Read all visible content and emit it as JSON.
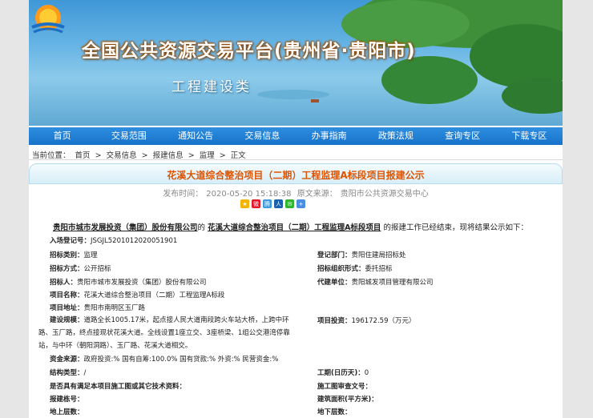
{
  "header": {
    "site_title": "全国公共资源交易平台(贵州省·贵阳市)",
    "site_subtitle": "工程建设类"
  },
  "nav": [
    "首页",
    "交易范围",
    "通知公告",
    "交易信息",
    "办事指南",
    "政策法规",
    "查询专区",
    "下载专区"
  ],
  "breadcrumb": {
    "prefix": "当前位置：",
    "items": [
      "首页",
      ">",
      "交易信息",
      ">",
      "报建信息",
      ">",
      "监理",
      ">",
      "正文"
    ]
  },
  "article": {
    "title": "花溪大道综合整治项目（二期）工程监理A标段项目报建公示",
    "publish_label": "发布时间：",
    "publish_time": "2020-05-20 15:18:38",
    "source_label": "原文来源：",
    "source": "贵阳市公共资源交易中心",
    "share_icons": [
      "qzone-icon",
      "weibo-icon",
      "tencent-weibo-icon",
      "renren-icon",
      "wechat-icon",
      "more-share-icon"
    ],
    "intro": {
      "org": "贵阳市城市发展投资（集团）股份有限公司",
      "mid": "的",
      "project": "花溪大道综合整治项目（二期）工程监理A标段项目",
      "tail": "的报建工作已经结束，现将结果公示如下："
    },
    "fields": {
      "reg_no_label": "入场登记号：",
      "reg_no": "JSGJL5201012020051901",
      "bid_type_label": "招标类别：",
      "bid_type": "监理",
      "reg_dept_label": "登记部门：",
      "reg_dept": "贵阳住建局招标处",
      "bid_method_label": "招标方式：",
      "bid_method": "公开招标",
      "bid_org_form_label": "招标组织形式：",
      "bid_org_form": "委托招标",
      "tenderer_label": "招标人：",
      "tenderer": "贵阳市城市发展投资（集团）股份有限公司",
      "agent_label": "代建单位：",
      "agent": "贵阳城发项目管理有限公司",
      "project_name_label": "项目名称：",
      "project_name": "花溪大道综合整治项目（二期）工程监理A标段",
      "project_addr_label": "项目地址：",
      "project_addr": "贵阳市南明区玉厂路",
      "scale_label": "建设规模：",
      "scale_line1": "道路全长1005.17米，起点接人民大道南段跨火车站大桥，上跨中环",
      "scale_line2": "路、玉厂路，终点接现状花溪大道。全线设置1座立交、3座桥梁、1组公交港湾停靠",
      "scale_line3": "站，与中环（朝阳洞路）、玉厂路、花溪大道相交。",
      "investment_label": "项目投资：",
      "investment": "196172.59（万元）",
      "fund_source_label": "资金来源：",
      "fund_source": "政府投资:% 国有自筹:100.0% 国有贷款:% 外资:% 民营资金:%",
      "structure_label": "结构类型：",
      "structure": "/",
      "duration_label": "工期(日历天)：",
      "duration": "0",
      "qualify_label": "是否具有满足本项目施工图或其它技术资料：",
      "qualify": "",
      "drawing_review_label": "施工图审查文号：",
      "drawing_review": "",
      "build_no_label": "报建栋号：",
      "build_no": "",
      "area_label": "建筑面积(平方米)：",
      "area": "",
      "floors_up_label": "地上层数：",
      "floors_up": "",
      "floors_down_label": "地下层数：",
      "floors_down": ""
    }
  }
}
